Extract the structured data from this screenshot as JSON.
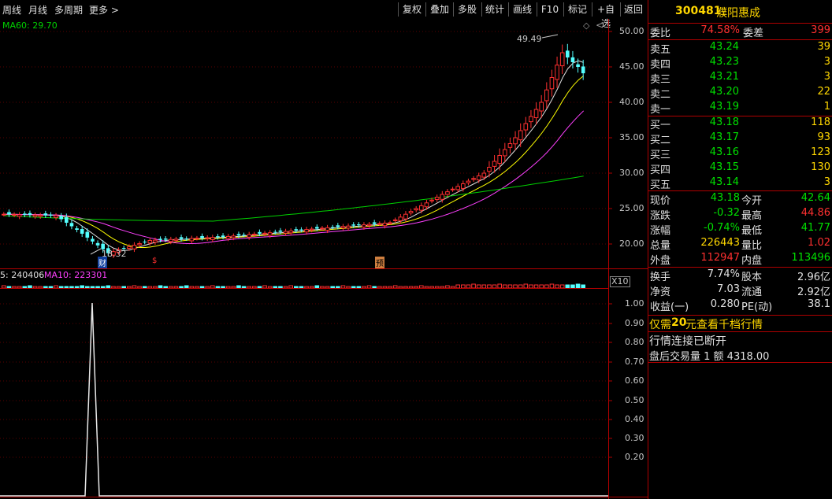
{
  "toolbar": {
    "left": [
      "周线",
      "月线",
      "多周期",
      "更多 >"
    ],
    "right": [
      "复权",
      "叠加",
      "多股",
      "统计",
      "画线",
      "F10",
      "标记",
      "+自选",
      "返回"
    ]
  },
  "main_chart": {
    "ma_label": "MA60: 29.70",
    "price_axis": [
      "50.00",
      "45.00",
      "40.00",
      "35.00",
      "30.00",
      "25.00",
      "20.00"
    ],
    "high_marker": "49.49",
    "low_marker": "18.32",
    "event_markers": [
      "财",
      "$",
      "预"
    ],
    "vol_legend_a": "5: 240406",
    "vol_legend_b": "MA10: 223301",
    "x10_label": "X10"
  },
  "indicator_chart": {
    "axis": [
      "1.00",
      "0.90",
      "0.80",
      "0.70",
      "0.60",
      "0.50",
      "0.40",
      "0.30",
      "0.20"
    ]
  },
  "panel": {
    "code": "300481",
    "name": "濮阳惠成",
    "weibi_label": "委比",
    "weibi_value": "74.58%",
    "weicha_label": "委差",
    "weicha_value": "399",
    "sells": [
      {
        "label": "卖五",
        "price": "43.24",
        "vol": "39"
      },
      {
        "label": "卖四",
        "price": "43.23",
        "vol": "3"
      },
      {
        "label": "卖三",
        "price": "43.21",
        "vol": "3"
      },
      {
        "label": "卖二",
        "price": "43.20",
        "vol": "22"
      },
      {
        "label": "卖一",
        "price": "43.19",
        "vol": "1"
      }
    ],
    "buys": [
      {
        "label": "买一",
        "price": "43.18",
        "vol": "118"
      },
      {
        "label": "买二",
        "price": "43.17",
        "vol": "93"
      },
      {
        "label": "买三",
        "price": "43.16",
        "vol": "123"
      },
      {
        "label": "买四",
        "price": "43.15",
        "vol": "130"
      },
      {
        "label": "买五",
        "price": "43.14",
        "vol": "3"
      }
    ],
    "quote": [
      {
        "l1": "现价",
        "v1": "43.18",
        "c1": "g",
        "l2": "今开",
        "v2": "42.64",
        "c2": "g"
      },
      {
        "l1": "涨跌",
        "v1": "-0.32",
        "c1": "g",
        "l2": "最高",
        "v2": "44.86",
        "c2": "r"
      },
      {
        "l1": "涨幅",
        "v1": "-0.74%",
        "c1": "g",
        "l2": "最低",
        "v2": "41.77",
        "c2": "g"
      },
      {
        "l1": "总量",
        "v1": "226443",
        "c1": "y",
        "l2": "量比",
        "v2": "1.02",
        "c2": "r"
      },
      {
        "l1": "外盘",
        "v1": "112947",
        "c1": "r",
        "l2": "内盘",
        "v2": "113496",
        "c2": "g"
      }
    ],
    "stats": [
      {
        "l1": "换手",
        "v1": "7.74%",
        "l2": "股本",
        "v2": "2.96亿"
      },
      {
        "l1": "净资",
        "v1": "7.03",
        "l2": "流通",
        "v2": "2.92亿"
      },
      {
        "l1": "收益(一)",
        "v1": "0.280",
        "l2": "PE(动)",
        "v2": "38.1"
      }
    ],
    "promo_a": "仅需",
    "promo_b": "20",
    "promo_c": "元查看千档行情",
    "disconnected": "行情连接已断开",
    "after_hours": "盘后交易量 1 额  4318.00"
  },
  "colors": {
    "up": "#ff3030",
    "down": "#54ffff",
    "ma5": "#e0e0e0",
    "ma10": "#ffff00",
    "ma20": "#ff40ff",
    "ma60": "#00d000",
    "frame": "#b00000"
  }
}
